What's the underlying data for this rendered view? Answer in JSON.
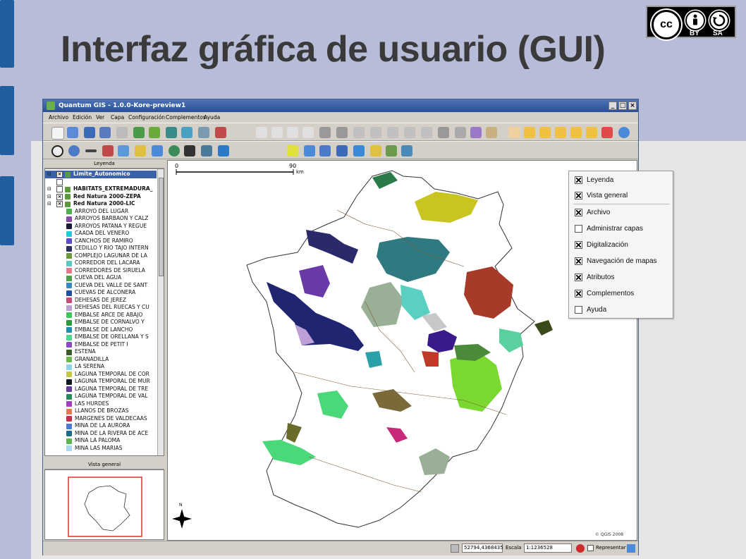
{
  "slide": {
    "title": "Interfaz gráfica de usuario (GUI)",
    "license": {
      "by": "BY",
      "sa": "SA",
      "cc": "cc"
    }
  },
  "window": {
    "title": "Quantum GIS - 1.0.0-Kore-preview1",
    "menu": [
      "Archivo",
      "Edición",
      "Ver",
      "Capa",
      "Configuración",
      "Complementos",
      "Ayuda"
    ]
  },
  "legend_panel": {
    "title": "Leyenda",
    "layers": [
      {
        "name": "Limite_Autonomico",
        "checked": true,
        "selected": true
      },
      {
        "name": "",
        "checked": false
      },
      {
        "name": "HABITATS_EXTREMADURA_",
        "checked": false,
        "bold": true
      },
      {
        "name": "Red Natura 2000-ZEPA",
        "checked": true,
        "bold": true
      },
      {
        "name": "Red Natura 2000-LIC",
        "checked": true,
        "bold": true
      }
    ],
    "classes": [
      {
        "name": "ARROYO DEL LUGAR",
        "color": "#4caf50"
      },
      {
        "name": "ARROYOS BARBAON Y CALZ",
        "color": "#8b4aa8"
      },
      {
        "name": "ARROYOS PATANA Y REGUE",
        "color": "#1a1a3a"
      },
      {
        "name": "CAADA DEL VENERO",
        "color": "#29c5d8"
      },
      {
        "name": "CANCHOS DE RAMIRO",
        "color": "#5a4fc8"
      },
      {
        "name": "CEDILLO Y RIO TAJO INTERN",
        "color": "#2e2e5e"
      },
      {
        "name": "COMPLEJO LAGUNAR DE LA",
        "color": "#6a9a3a"
      },
      {
        "name": "CORREDOR DEL LACARA",
        "color": "#5ac8c0"
      },
      {
        "name": "CORREDORES DE SIRUELA",
        "color": "#e07a8a"
      },
      {
        "name": "CUEVA DEL AGUA",
        "color": "#4aa04a"
      },
      {
        "name": "CUEVA DEL VALLE DE SANT",
        "color": "#3a8abf"
      },
      {
        "name": "CUEVAS DE ALCONERA",
        "color": "#1f4f9f"
      },
      {
        "name": "DEHESAS DE JEREZ",
        "color": "#c84a7a"
      },
      {
        "name": "DEHESAS DEL RUECAS Y CU",
        "color": "#bda0d8"
      },
      {
        "name": "EMBALSE ARCE DE ABAJO",
        "color": "#3ac85a"
      },
      {
        "name": "EMBALSE DE CORNALVO Y",
        "color": "#2a9a3a"
      },
      {
        "name": "EMBALSE DE LANCHO",
        "color": "#1f8fb0"
      },
      {
        "name": "EMBALSE DE ORELLANA Y S",
        "color": "#4ad88a"
      },
      {
        "name": "EMBALSE DE PETIT I",
        "color": "#8a4ac8"
      },
      {
        "name": "ESTENA",
        "color": "#3a5a2a"
      },
      {
        "name": "GRANADILLA",
        "color": "#6ab84a"
      },
      {
        "name": "LA SERENA",
        "color": "#8ad8e8"
      },
      {
        "name": "LAGUNA TEMPORAL DE COR",
        "color": "#c8c840"
      },
      {
        "name": "LAGUNA TEMPORAL DE MUR",
        "color": "#101820"
      },
      {
        "name": "LAGUNA TEMPORAL DE TRE",
        "color": "#6a3a9a"
      },
      {
        "name": "LAGUNA TEMPORAL DE VAL",
        "color": "#2a8a5a"
      },
      {
        "name": "LAS HURDES",
        "color": "#a040c0"
      },
      {
        "name": "LLANOS DE BROZAS",
        "color": "#e07a4a"
      },
      {
        "name": "MARGENES DE VALDECAAS",
        "color": "#c8304a"
      },
      {
        "name": "MINA DE LA AURORA",
        "color": "#4a7ad8"
      },
      {
        "name": "MINA DE LA RIVERA DE ACE",
        "color": "#1a6a8a"
      },
      {
        "name": "MINA LA PALOMA",
        "color": "#5ab84a"
      },
      {
        "name": "MINA LAS MARIAS",
        "color": "#a8d8f0"
      }
    ]
  },
  "overview_panel": {
    "title": "Vista general"
  },
  "map": {
    "scalebar": {
      "start": "0",
      "end": "90",
      "unit": "km"
    },
    "north": "N",
    "copyright": "© QGIS 2008"
  },
  "status": {
    "coords": "52794,4368435",
    "scale_label": "Escala",
    "scale_value": "1:1236528",
    "render_label": "Representar"
  },
  "popup": {
    "items": [
      {
        "label": "Leyenda",
        "checked": true
      },
      {
        "label": "Vista general",
        "checked": true
      },
      {
        "label": "Archivo",
        "checked": true
      },
      {
        "label": "Administrar capas",
        "checked": false
      },
      {
        "label": "Digitalización",
        "checked": true
      },
      {
        "label": "Navegación de mapas",
        "checked": true
      },
      {
        "label": "Atributos",
        "checked": true
      },
      {
        "label": "Complementos",
        "checked": true
      },
      {
        "label": "Ayuda",
        "checked": false
      }
    ]
  },
  "colors": {
    "accent": "#1f5f9f",
    "titlebar": "#2b4f96",
    "outline": "#555555"
  }
}
